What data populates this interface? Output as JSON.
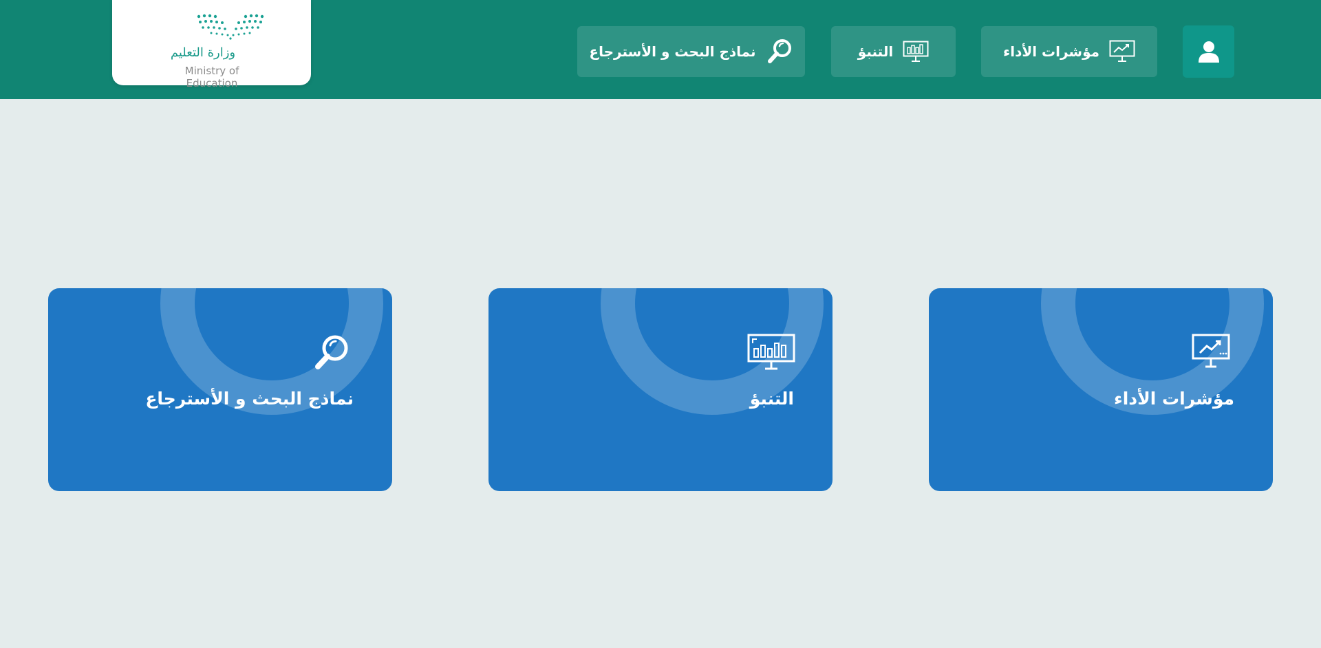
{
  "logo": {
    "arabic": "وزارة التعليم",
    "english": "Ministry of Education"
  },
  "nav": {
    "items": [
      {
        "label": "نماذج البحث و الأسترجاع",
        "icon": "search-icon"
      },
      {
        "label": "التنبؤ",
        "icon": "monitor-bars-icon"
      },
      {
        "label": "مؤشرات الأداء",
        "icon": "monitor-trend-icon"
      }
    ],
    "profile_icon": "user-icon"
  },
  "cards": [
    {
      "title": "مؤشرات الأداء",
      "icon": "monitor-trend-icon"
    },
    {
      "title": "التنبؤ",
      "icon": "monitor-bars-icon"
    },
    {
      "title": "نماذج البحث و الأسترجاع",
      "icon": "search-icon"
    }
  ],
  "colors": {
    "header": "#118573",
    "background": "#e4ecec",
    "card": "#1f77c4",
    "profile_button": "#0f978a"
  }
}
